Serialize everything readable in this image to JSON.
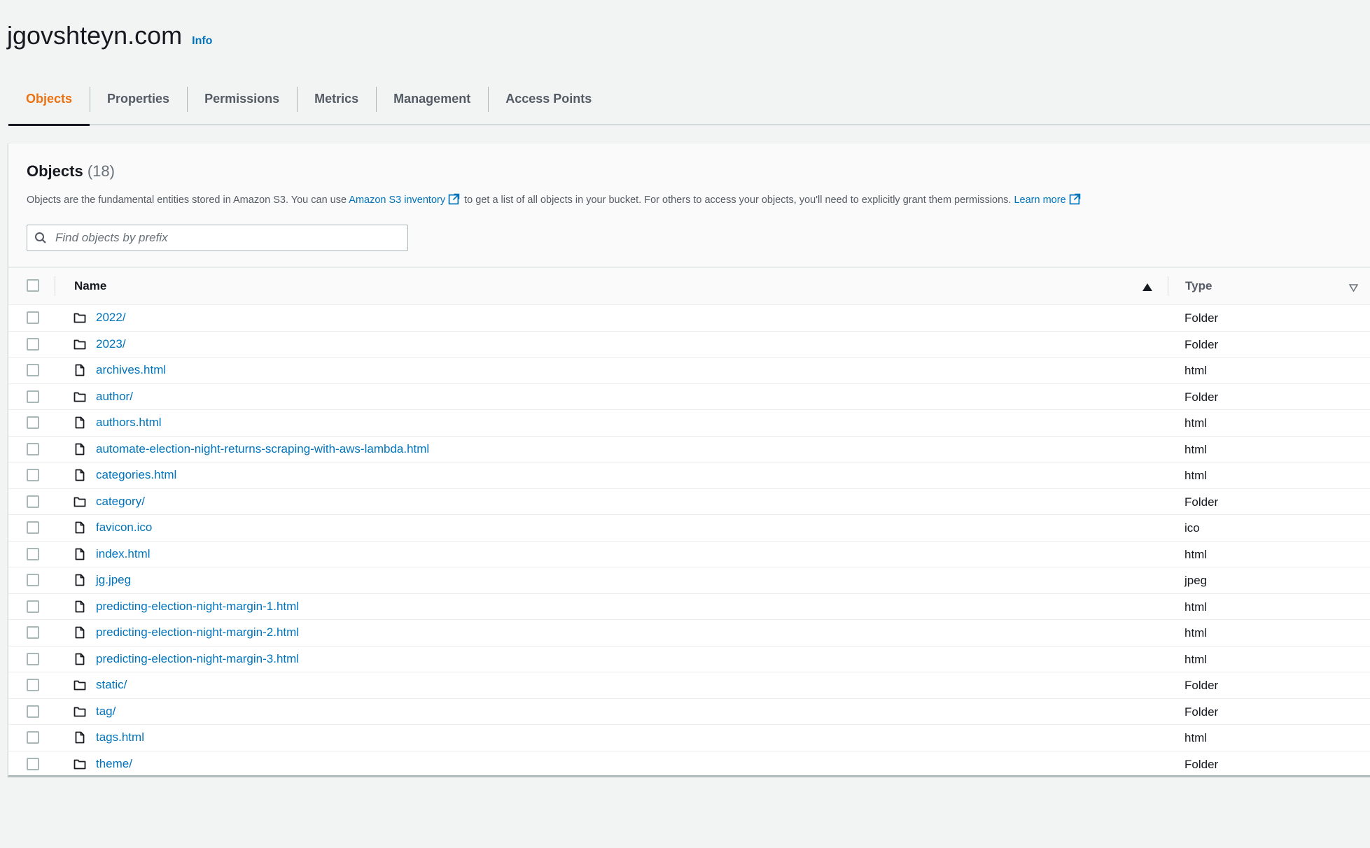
{
  "header": {
    "bucket_name": "jgovshteyn.com",
    "info_label": "Info"
  },
  "tabs": [
    {
      "label": "Objects",
      "active": true
    },
    {
      "label": "Properties",
      "active": false
    },
    {
      "label": "Permissions",
      "active": false
    },
    {
      "label": "Metrics",
      "active": false
    },
    {
      "label": "Management",
      "active": false
    },
    {
      "label": "Access Points",
      "active": false
    }
  ],
  "objects_panel": {
    "heading": "Objects",
    "count": "(18)",
    "description_pre": "Objects are the fundamental entities stored in Amazon S3. You can use",
    "inventory_link": "Amazon S3 inventory",
    "description_mid": "to get a list of all objects in your bucket. For others to access your objects, you'll need to explicitly grant them permissions.",
    "learn_more_link": "Learn more",
    "search_placeholder": "Find objects by prefix"
  },
  "table": {
    "columns": {
      "name": "Name",
      "type": "Type"
    },
    "rows": [
      {
        "name": "2022/",
        "type": "Folder",
        "icon": "folder-icon"
      },
      {
        "name": "2023/",
        "type": "Folder",
        "icon": "folder-icon"
      },
      {
        "name": "archives.html",
        "type": "html",
        "icon": "file-icon"
      },
      {
        "name": "author/",
        "type": "Folder",
        "icon": "folder-icon"
      },
      {
        "name": "authors.html",
        "type": "html",
        "icon": "file-icon"
      },
      {
        "name": "automate-election-night-returns-scraping-with-aws-lambda.html",
        "type": "html",
        "icon": "file-icon"
      },
      {
        "name": "categories.html",
        "type": "html",
        "icon": "file-icon"
      },
      {
        "name": "category/",
        "type": "Folder",
        "icon": "folder-icon"
      },
      {
        "name": "favicon.ico",
        "type": "ico",
        "icon": "file-icon"
      },
      {
        "name": "index.html",
        "type": "html",
        "icon": "file-icon"
      },
      {
        "name": "jg.jpeg",
        "type": "jpeg",
        "icon": "file-icon"
      },
      {
        "name": "predicting-election-night-margin-1.html",
        "type": "html",
        "icon": "file-icon"
      },
      {
        "name": "predicting-election-night-margin-2.html",
        "type": "html",
        "icon": "file-icon"
      },
      {
        "name": "predicting-election-night-margin-3.html",
        "type": "html",
        "icon": "file-icon"
      },
      {
        "name": "static/",
        "type": "Folder",
        "icon": "folder-icon"
      },
      {
        "name": "tag/",
        "type": "Folder",
        "icon": "folder-icon"
      },
      {
        "name": "tags.html",
        "type": "html",
        "icon": "file-icon"
      },
      {
        "name": "theme/",
        "type": "Folder",
        "icon": "folder-icon"
      }
    ]
  },
  "colors": {
    "accent_active_tab": "#ec7211",
    "link": "#0073bb",
    "background": "#f2f3f3"
  }
}
